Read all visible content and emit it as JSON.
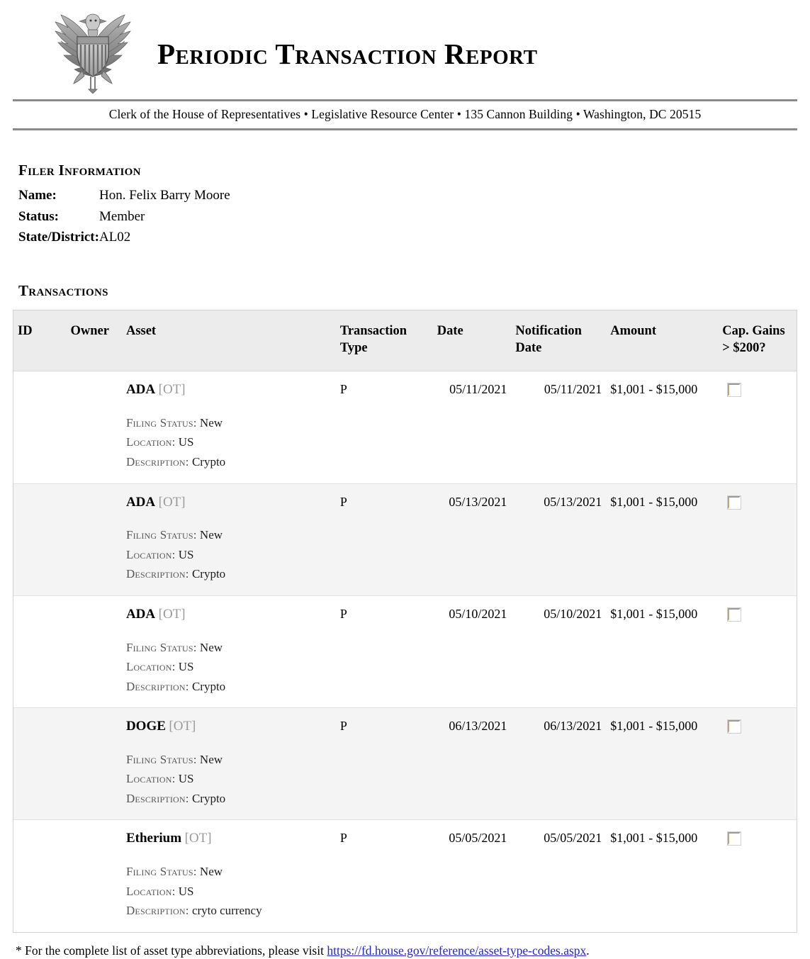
{
  "header": {
    "seal_icon": "us-house-eagle-seal-icon",
    "title": "Periodic Transaction Report",
    "subtitle": "Clerk of the House of Representatives • Legislative Resource Center • 135 Cannon Building • Washington, DC 20515"
  },
  "filer": {
    "heading": "Filer Information",
    "rows": [
      {
        "label": "Name:",
        "value": "Hon. Felix Barry Moore"
      },
      {
        "label": "Status:",
        "value": "Member"
      },
      {
        "label": "State/District:",
        "value": "AL02"
      }
    ]
  },
  "transactions": {
    "heading": "Transactions",
    "columns": {
      "id": "ID",
      "owner": "Owner",
      "asset": "Asset",
      "transaction_type": "Transaction Type",
      "date": "Date",
      "notification_date": "Notification Date",
      "amount": "Amount",
      "cap_gains": "Cap. Gains > $200?"
    },
    "meta_labels": {
      "filing_status": "Filing Status:",
      "location": "Location:",
      "description": "Description:"
    },
    "rows": [
      {
        "id": "",
        "owner": "",
        "asset_name": "ADA",
        "asset_code": "[OT]",
        "transaction_type": "P",
        "date": "05/11/2021",
        "notification_date": "05/11/2021",
        "amount": "$1,001 - $15,000",
        "cap_gains_checked": false,
        "filing_status": "New",
        "location": "US",
        "description": "Crypto"
      },
      {
        "id": "",
        "owner": "",
        "asset_name": "ADA",
        "asset_code": "[OT]",
        "transaction_type": "P",
        "date": "05/13/2021",
        "notification_date": "05/13/2021",
        "amount": "$1,001 - $15,000",
        "cap_gains_checked": false,
        "filing_status": "New",
        "location": "US",
        "description": "Crypto"
      },
      {
        "id": "",
        "owner": "",
        "asset_name": "ADA",
        "asset_code": "[OT]",
        "transaction_type": "P",
        "date": "05/10/2021",
        "notification_date": "05/10/2021",
        "amount": "$1,001 - $15,000",
        "cap_gains_checked": false,
        "filing_status": "New",
        "location": "US",
        "description": "Crypto"
      },
      {
        "id": "",
        "owner": "",
        "asset_name": "DOGE",
        "asset_code": "[OT]",
        "transaction_type": "P",
        "date": "06/13/2021",
        "notification_date": "06/13/2021",
        "amount": "$1,001 - $15,000",
        "cap_gains_checked": false,
        "filing_status": "New",
        "location": "US",
        "description": "Crypto"
      },
      {
        "id": "",
        "owner": "",
        "asset_name": "Etherium",
        "asset_code": "[OT]",
        "transaction_type": "P",
        "date": "05/05/2021",
        "notification_date": "05/05/2021",
        "amount": "$1,001 - $15,000",
        "cap_gains_checked": false,
        "filing_status": "New",
        "location": "US",
        "description": "cryto currency"
      }
    ]
  },
  "footnote": {
    "prefix": "* For the complete list of asset type abbreviations, please visit ",
    "link_text": "https://fd.house.gov/reference/asset-type-codes.aspx",
    "suffix": "."
  },
  "colors": {
    "header_band": "#ececec",
    "alt_row": "#f4f4f4",
    "rule": "#8a8a8a",
    "link": "#2525c8",
    "asset_code": "#9a9a9a"
  }
}
